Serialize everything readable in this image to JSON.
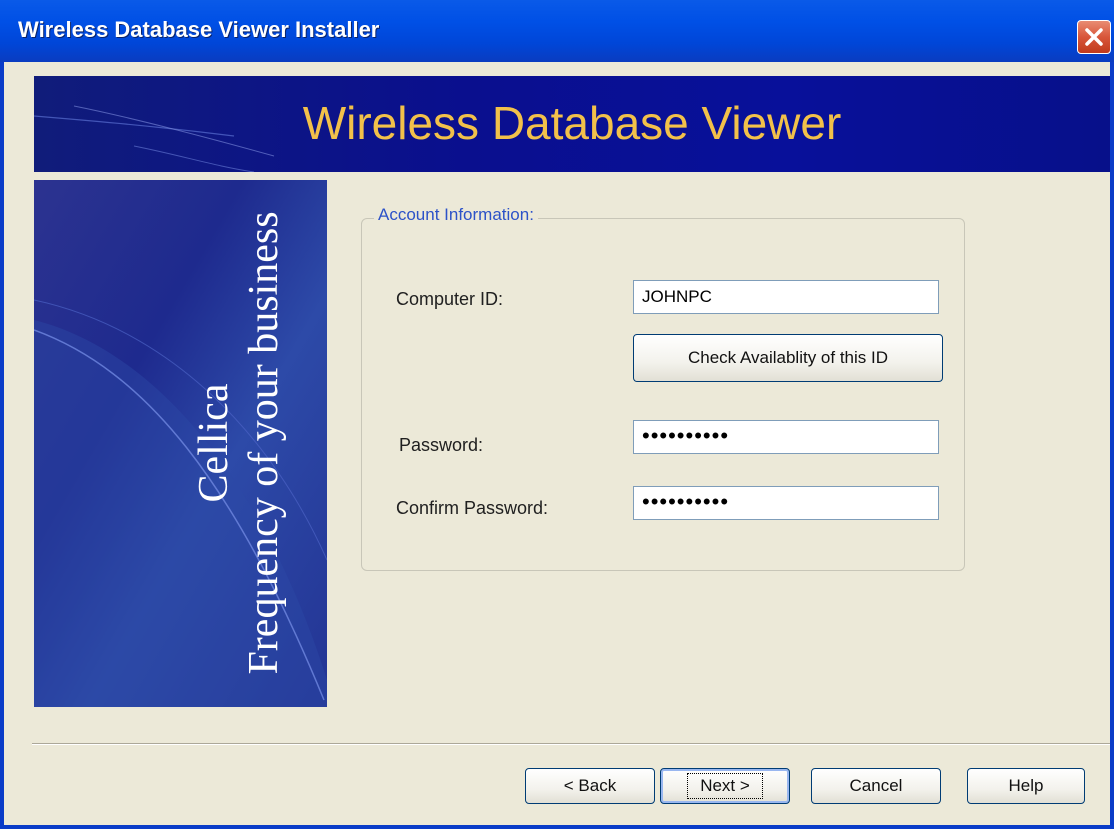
{
  "window": {
    "title": "Wireless Database Viewer Installer"
  },
  "banner": {
    "title": "Wireless Database Viewer"
  },
  "sidebar": {
    "brand": "Cellica",
    "tagline": "Frequency of your business"
  },
  "account": {
    "group_label": "Account Information:",
    "computer_id_label": "Computer ID:",
    "computer_id_value": "JOHNPC",
    "check_button": "Check Availablity of this ID",
    "password_label": "Password:",
    "password_value": "••••••••••",
    "confirm_label": "Confirm Password:",
    "confirm_value": "••••••••••"
  },
  "buttons": {
    "back": "< Back",
    "next": "Next >",
    "cancel": "Cancel",
    "help": "Help"
  },
  "colors": {
    "banner_text": "#f2c14a",
    "titlebar": "#0050e6",
    "dialog_bg": "#ece9d8",
    "close": "#d8563a"
  },
  "icons": {
    "close": "close-icon"
  }
}
